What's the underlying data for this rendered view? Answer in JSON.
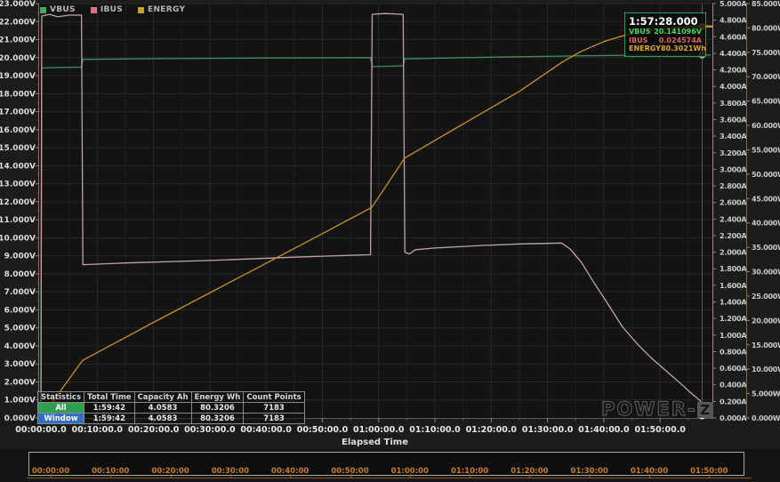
{
  "legend": {
    "items": [
      {
        "label": "VBUS",
        "color": "#3fae57"
      },
      {
        "label": "IBUS",
        "color": "#d9737e"
      },
      {
        "label": "ENERGY",
        "color": "#c9a227"
      }
    ]
  },
  "tooltip": {
    "time": "1:57:28.000",
    "rows": [
      {
        "label": "VBUS",
        "value": "20.141096V",
        "color": "#46d35e"
      },
      {
        "label": "IBUS",
        "value": "0.024574A",
        "color": "#e06060"
      },
      {
        "label": "ENERGY",
        "value": "80.3021Wh",
        "color": "#e2a42a"
      }
    ]
  },
  "x_axis": {
    "label": "Elapsed Time",
    "ticks": [
      "00:00:00.0",
      "00:10:00.0",
      "00:20:00.0",
      "00:30:00.0",
      "00:40:00.0",
      "00:50:00.0",
      "01:00:00.0",
      "01:10:00.0",
      "01:20:00.0",
      "01:30:00.0",
      "01:40:00.0",
      "01:50:00.0"
    ]
  },
  "timeline": {
    "ticks": [
      "00:00:00",
      "00:10:00",
      "00:20:00",
      "00:30:00",
      "00:40:00",
      "00:50:00",
      "01:00:00",
      "01:10:00",
      "01:20:00",
      "01:30:00",
      "01:40:00",
      "01:50:00"
    ]
  },
  "stats_table": {
    "headers": [
      "Statistics",
      "Total Time",
      "Capacity Ah",
      "Energy Wh",
      "Count Points"
    ],
    "rows": [
      {
        "name": "All",
        "color": "#2f9e4d",
        "cells": [
          "1:59:42",
          "4.0583",
          "80.3206",
          "7183"
        ]
      },
      {
        "name": "Window",
        "color": "#2f6fc4",
        "cells": [
          "1:59:42",
          "4.0583",
          "80.3206",
          "7183"
        ]
      }
    ]
  },
  "watermark": {
    "text": "POWER-",
    "logo": "Z"
  },
  "chart_data": {
    "type": "line",
    "title": "",
    "xlabel": "Elapsed Time",
    "x_unit": "minutes",
    "x_range_minutes": [
      0,
      119.3
    ],
    "grid": true,
    "y_axes": {
      "voltage": {
        "unit": "V",
        "min": 0,
        "max": 23,
        "step": 1,
        "decimals": 3,
        "side": "left",
        "axis_color": "#4a8f68",
        "label_color": "#dcdcdc"
      },
      "current": {
        "unit": "A",
        "min": 0,
        "max": 5,
        "step": 0.2,
        "decimals": 3,
        "side": "right",
        "axis_color": "#a8898d",
        "label_color": "#c8c8c8"
      },
      "energy": {
        "unit": "Wh",
        "min": 0,
        "max": 85,
        "step": 5,
        "decimals": 3,
        "side": "right2",
        "axis_color": "#8f6a14",
        "label_color": "#c8c8c8"
      }
    },
    "series": [
      {
        "name": "VBUS",
        "axis": "voltage",
        "color": "#3f8f5c",
        "points": [
          [
            0,
            0
          ],
          [
            0.15,
            19.42
          ],
          [
            3,
            19.45
          ],
          [
            7.2,
            19.47
          ],
          [
            7.45,
            19.9
          ],
          [
            20,
            19.94
          ],
          [
            40,
            19.98
          ],
          [
            58.55,
            20.0
          ],
          [
            58.85,
            19.5
          ],
          [
            62,
            19.52
          ],
          [
            64.35,
            19.55
          ],
          [
            64.65,
            19.93
          ],
          [
            75,
            20.0
          ],
          [
            85,
            20.05
          ],
          [
            95,
            20.1
          ],
          [
            105,
            20.13
          ],
          [
            119,
            20.14
          ]
        ]
      },
      {
        "name": "IBUS",
        "axis": "current",
        "color": "#c4a3a6",
        "points": [
          [
            0,
            0
          ],
          [
            0.15,
            4.85
          ],
          [
            1.5,
            4.87
          ],
          [
            3,
            4.84
          ],
          [
            5,
            4.86
          ],
          [
            7.2,
            4.86
          ],
          [
            7.45,
            1.85
          ],
          [
            15,
            1.87
          ],
          [
            30,
            1.9
          ],
          [
            45,
            1.94
          ],
          [
            58.55,
            1.97
          ],
          [
            58.85,
            4.87
          ],
          [
            61,
            4.88
          ],
          [
            64.35,
            4.87
          ],
          [
            64.65,
            2.0
          ],
          [
            65.5,
            1.98
          ],
          [
            66.5,
            2.03
          ],
          [
            70,
            2.05
          ],
          [
            78,
            2.08
          ],
          [
            85,
            2.1
          ],
          [
            92.5,
            2.11
          ],
          [
            94,
            2.04
          ],
          [
            96,
            1.88
          ],
          [
            98,
            1.66
          ],
          [
            100.6,
            1.39
          ],
          [
            103.3,
            1.1
          ],
          [
            106,
            0.89
          ],
          [
            108.5,
            0.72
          ],
          [
            111.2,
            0.56
          ],
          [
            113.9,
            0.4
          ],
          [
            115.5,
            0.3
          ],
          [
            117.1,
            0.21
          ],
          [
            117.5,
            0.12
          ],
          [
            117.8,
            0.03
          ],
          [
            119,
            0.02
          ]
        ]
      },
      {
        "name": "ENERGY",
        "axis": "energy",
        "color": "#cc921e",
        "points": [
          [
            0,
            0
          ],
          [
            2,
            3.2
          ],
          [
            7.4,
            11.8
          ],
          [
            20,
            19.6
          ],
          [
            35,
            28.7
          ],
          [
            50,
            37.8
          ],
          [
            58.8,
            43.2
          ],
          [
            64.6,
            53.3
          ],
          [
            75,
            60.3
          ],
          [
            85,
            67.0
          ],
          [
            92.6,
            73.0
          ],
          [
            96,
            75.2
          ],
          [
            100,
            77.2
          ],
          [
            104,
            78.6
          ],
          [
            108,
            79.5
          ],
          [
            112,
            80.0
          ],
          [
            115,
            80.2
          ],
          [
            119,
            80.32
          ]
        ]
      }
    ],
    "cursor": {
      "time_minutes": 117.467,
      "values": {
        "VBUS": 20.141096,
        "IBUS": 0.024574,
        "ENERGY": 80.3021
      }
    }
  }
}
